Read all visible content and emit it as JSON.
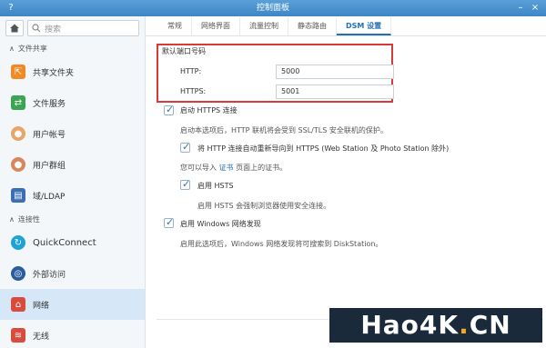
{
  "window": {
    "title": "控制面板"
  },
  "sidebar": {
    "search_placeholder": "搜索",
    "section_file": "文件共享",
    "section_conn": "连接性",
    "items": [
      {
        "label": "共享文件夹"
      },
      {
        "label": "文件服务"
      },
      {
        "label": "用户帐号"
      },
      {
        "label": "用户群组"
      },
      {
        "label": "域/LDAP"
      },
      {
        "label": "QuickConnect"
      },
      {
        "label": "外部访问"
      },
      {
        "label": "网络"
      },
      {
        "label": "无线"
      }
    ]
  },
  "tabs": [
    {
      "label": "常规"
    },
    {
      "label": "网络界面"
    },
    {
      "label": "流量控制"
    },
    {
      "label": "静态路由"
    },
    {
      "label": "DSM 设置"
    }
  ],
  "ports": {
    "group_title": "默认端口号码",
    "http_label": "HTTP:",
    "http_value": "5000",
    "https_label": "HTTPS:",
    "https_value": "5001"
  },
  "https": {
    "enable_label": "启动 HTTPS 连接",
    "enable_desc": "启动本选项后，HTTP 联机将会受到 SSL/TLS 安全联机的保护。",
    "redirect_label": "将 HTTP 连接自动重新导向到 HTTPS (Web Station 及 Photo Station 除外)",
    "import_pre": "您可以导入",
    "import_link": "证书",
    "import_post": "页面上的证书。",
    "hsts_label": "启用 HSTS",
    "hsts_desc": "启用 HSTS 会强制浏览器使用安全连接。"
  },
  "windows_discovery": {
    "label": "启用 Windows 网络发现",
    "desc": "启用此选项后，Windows 网络发现将可搜索到 DiskStation。"
  },
  "watermark": {
    "main": "Hao4K",
    "dot": ".",
    "tld": "CN"
  }
}
